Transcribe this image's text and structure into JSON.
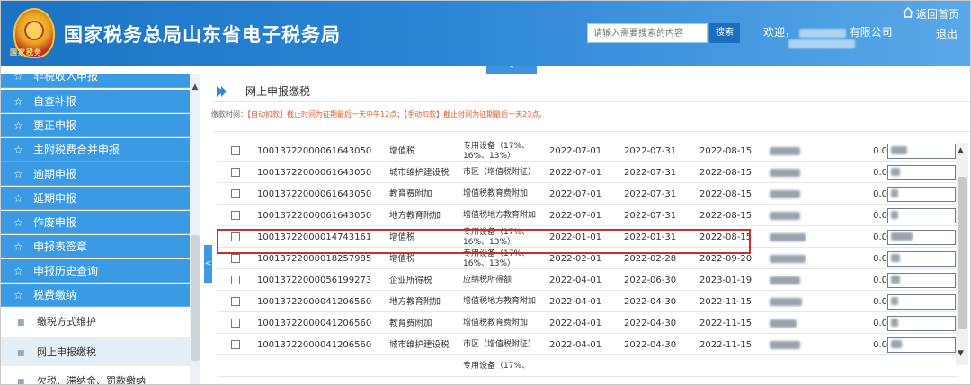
{
  "header": {
    "emblem_text": "国家税务",
    "title": "国家税务总局山东省电子税务局",
    "search_placeholder": "请输入需要搜索的内容",
    "search_button": "搜索",
    "welcome_prefix": "欢迎，",
    "welcome_suffix": "有限公司",
    "home_label": "返回首页",
    "logout_label": "退出",
    "collapse_arrow": "^"
  },
  "sidebar": {
    "items": [
      {
        "label": "非税收入申报"
      },
      {
        "label": "自查补报"
      },
      {
        "label": "更正申报"
      },
      {
        "label": "主附税费合并申报"
      },
      {
        "label": "逾期申报"
      },
      {
        "label": "延期申报"
      },
      {
        "label": "作废申报"
      },
      {
        "label": "申报表签章"
      },
      {
        "label": "申报历史查询"
      },
      {
        "label": "税费缴纳"
      }
    ],
    "subitems": [
      {
        "label": "缴税方式维护"
      },
      {
        "label": "网上申报缴税"
      },
      {
        "label": "欠税、滞纳金、罚款缴纳"
      }
    ],
    "star": "☆",
    "dot": "■",
    "toggle": "<"
  },
  "main": {
    "page_title": "网上申报缴税",
    "notice_label": "缴款时间：",
    "notice_text": "【自动扣款】截止时间为征期最后一天中午12点；【手动扣款】截止时间为征期最后一天23点。"
  },
  "table": {
    "rows": [
      {
        "no": "10013722000061643050",
        "tax": "增值税",
        "item": "专用设备（17%、16%、13%）",
        "d1": "2022-07-01",
        "d2": "2022-07-31",
        "d3": "2022-08-15",
        "zero": "0.0"
      },
      {
        "no": "10013722000061643050",
        "tax": "城市维护建设税",
        "item": "市区（增值税附征）",
        "d1": "2022-07-01",
        "d2": "2022-07-31",
        "d3": "2022-08-15",
        "zero": "0.0"
      },
      {
        "no": "10013722000061643050",
        "tax": "教育费附加",
        "item": "增值税教育费附加",
        "d1": "2022-07-01",
        "d2": "2022-07-31",
        "d3": "2022-08-15",
        "zero": "0.0"
      },
      {
        "no": "10013722000061643050",
        "tax": "地方教育附加",
        "item": "增值税地方教育附加",
        "d1": "2022-07-01",
        "d2": "2022-07-31",
        "d3": "2022-08-15",
        "zero": "0.0"
      },
      {
        "no": "10013722000014743161",
        "tax": "增值税",
        "item": "专用设备（17%、16%、13%）",
        "d1": "2022-01-01",
        "d2": "2022-01-31",
        "d3": "2022-08-15",
        "zero": "0.0"
      },
      {
        "no": "10013722000018257985",
        "tax": "增值税",
        "item": "专用设备（17%、16%、13%）",
        "d1": "2022-02-01",
        "d2": "2022-02-28",
        "d3": "2022-09-20",
        "zero": "0.0"
      },
      {
        "no": "10013722000056199273",
        "tax": "企业所得税",
        "item": "应纳税所得额",
        "d1": "2022-04-01",
        "d2": "2022-06-30",
        "d3": "2023-01-19",
        "zero": "0.0"
      },
      {
        "no": "10013722000041206560",
        "tax": "地方教育附加",
        "item": "增值税地方教育附加",
        "d1": "2022-04-01",
        "d2": "2022-04-30",
        "d3": "2022-11-15",
        "zero": "0.0"
      },
      {
        "no": "10013722000041206560",
        "tax": "教育费附加",
        "item": "增值税教育费附加",
        "d1": "2022-04-01",
        "d2": "2022-04-30",
        "d3": "2022-11-15",
        "zero": "0.0"
      },
      {
        "no": "10013722000041206560",
        "tax": "城市维护建设税",
        "item": "市区（增值税附征）",
        "d1": "2022-04-01",
        "d2": "2022-04-30",
        "d3": "2022-11-15",
        "zero": "0.0"
      },
      {
        "no": "",
        "tax": "",
        "item": "专用设备（17%、",
        "d1": "",
        "d2": "",
        "d3": "",
        "zero": ""
      }
    ]
  },
  "colors": {
    "header": "#1c73c4",
    "sidebar": "#3a9ae3",
    "highlight": "#d02a2a",
    "notice": "#e05a2b"
  }
}
